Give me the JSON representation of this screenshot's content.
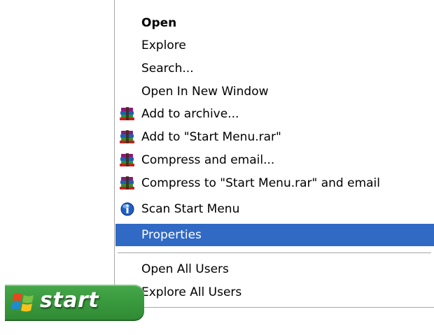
{
  "menu": {
    "items": [
      {
        "label": "Open",
        "icon": null,
        "bold": true
      },
      {
        "label": "Explore",
        "icon": null
      },
      {
        "label": "Search...",
        "icon": null
      },
      {
        "label": "Open In New Window",
        "icon": null
      },
      {
        "label": "Add to archive...",
        "icon": "winrar-icon"
      },
      {
        "label": "Add to \"Start Menu.rar\"",
        "icon": "winrar-icon"
      },
      {
        "label": "Compress and email...",
        "icon": "winrar-icon"
      },
      {
        "label": "Compress to \"Start Menu.rar\" and email",
        "icon": "winrar-icon"
      },
      {
        "label": "Scan Start Menu",
        "icon": "antivirus-icon"
      },
      {
        "label": "Properties",
        "icon": null,
        "highlighted": true
      },
      {
        "label": "Open All Users",
        "icon": null
      },
      {
        "label": "Explore All Users",
        "icon": null
      }
    ]
  },
  "taskbar": {
    "start_label": "start",
    "start_color": "#3a9a3e"
  },
  "colors": {
    "highlight": "#316ac5",
    "menu_border": "#a6a6a6"
  }
}
